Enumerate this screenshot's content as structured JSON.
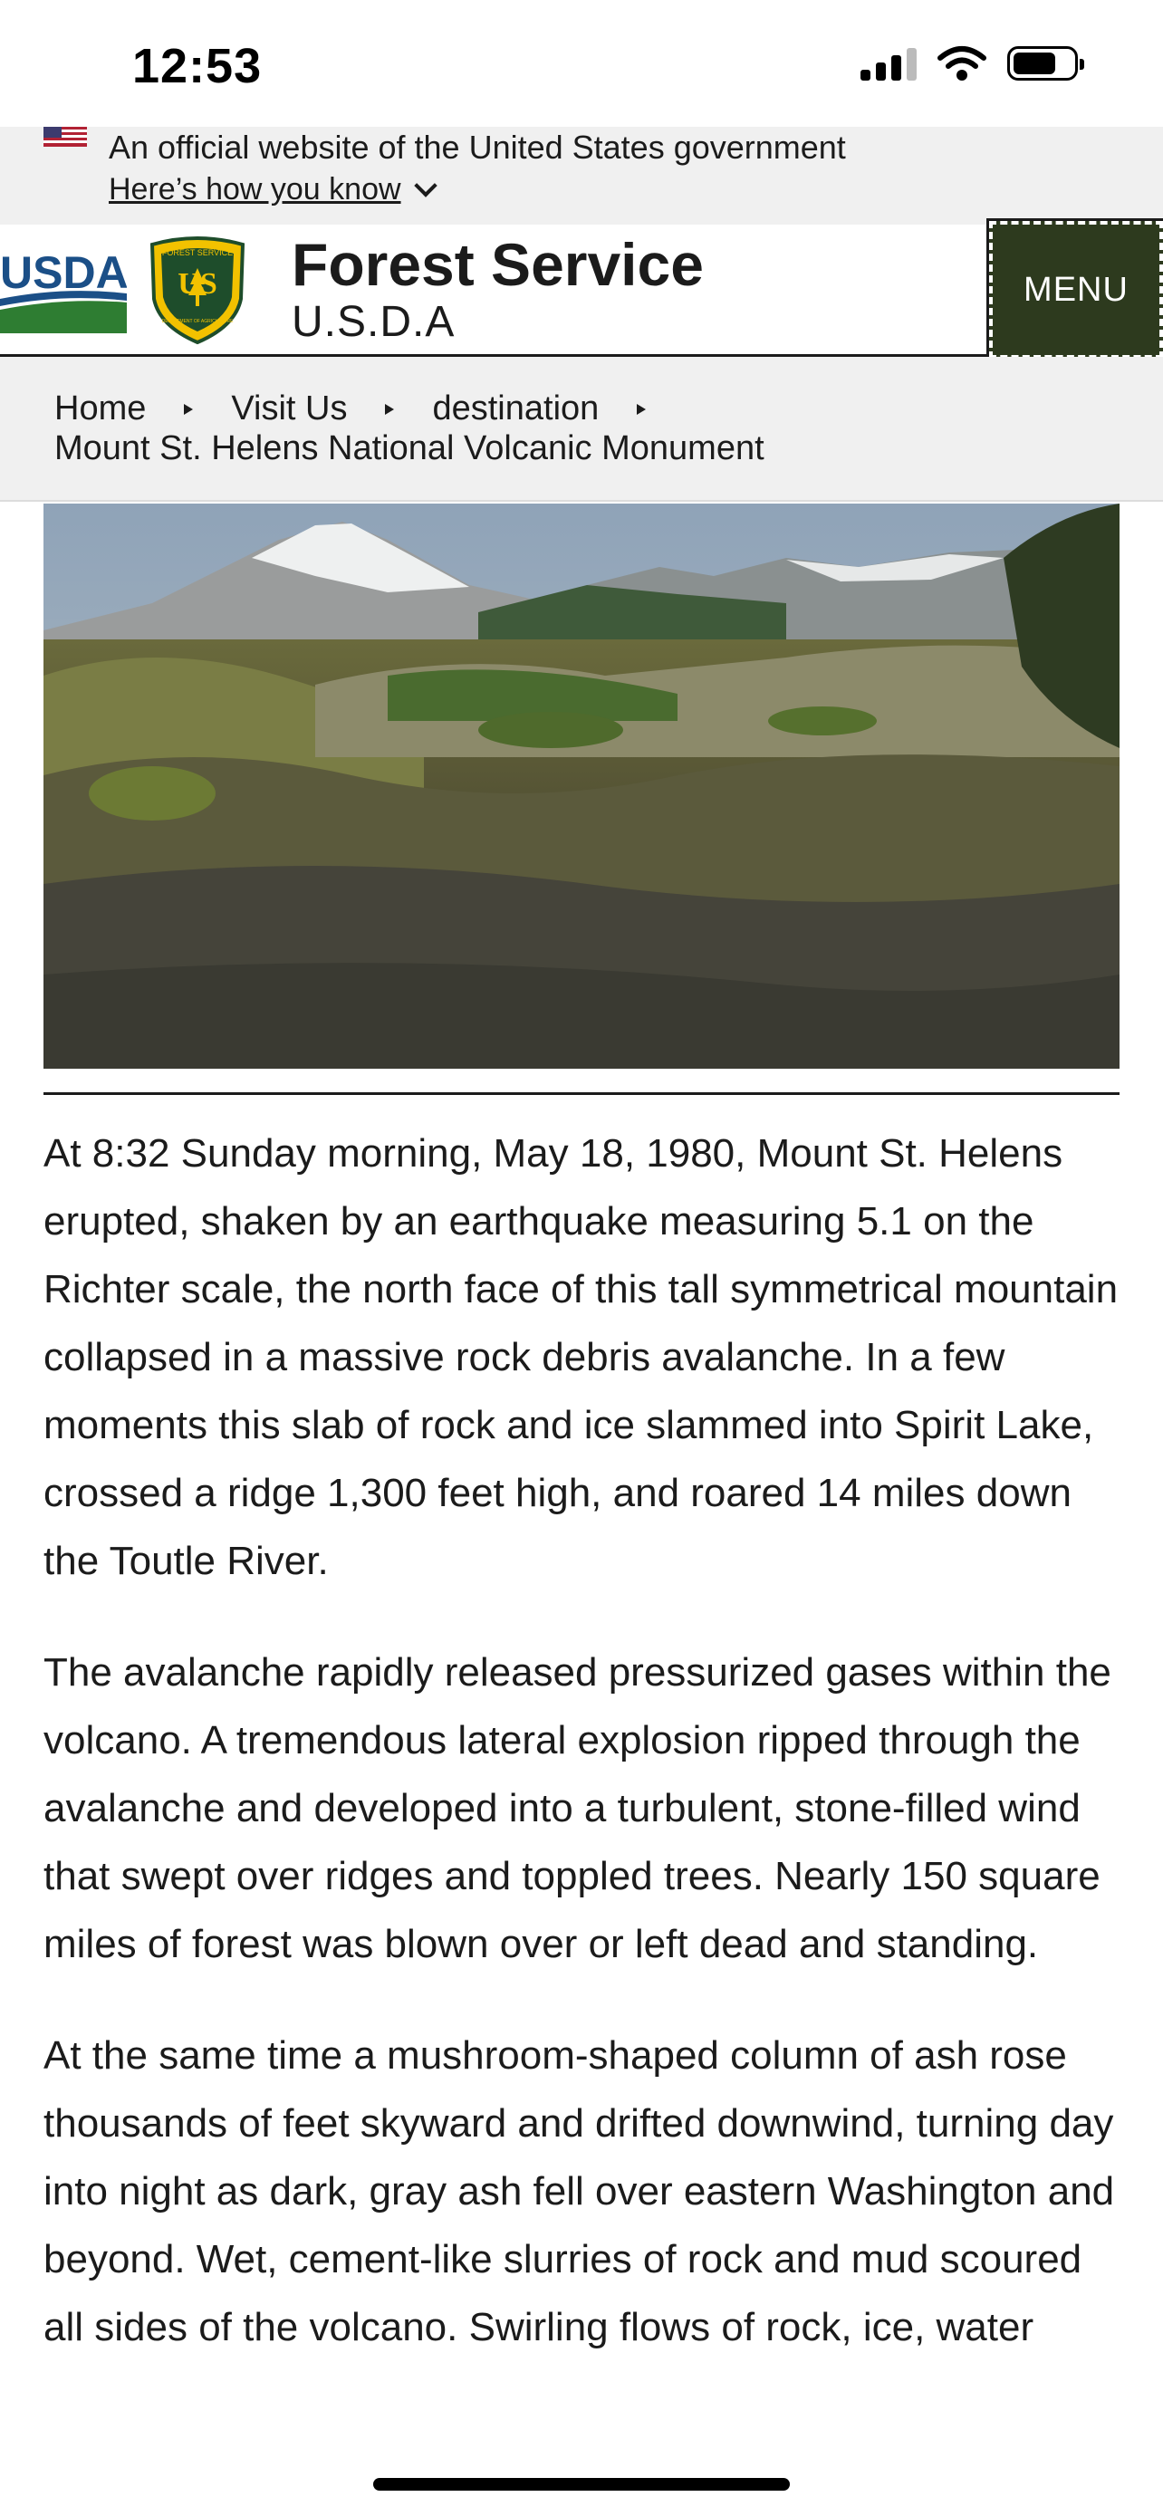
{
  "status_bar": {
    "time": "12:53"
  },
  "gov_banner": {
    "text": "An official website of the United States government",
    "link": "Here’s how you know"
  },
  "header": {
    "logo_text": "USDA",
    "shield_text": "FOREST SERVICE",
    "shield_monogram": "US",
    "shield_bottom_text": "DEPARTMENT OF AGRICULTURE",
    "title": "Forest Service",
    "subtitle": "U.S.D.A",
    "menu_label": "MENU"
  },
  "breadcrumb": {
    "items": [
      "Home",
      "Visit Us",
      "destination"
    ],
    "current": "Mount St. Helens National Volcanic Monument"
  },
  "colors": {
    "accent_green": "#2d3a1e",
    "usda_blue": "#1b4f87",
    "usda_green": "#2e7d32",
    "shield_yellow": "#f2c200"
  },
  "article": {
    "paragraphs": [
      "At 8:32 Sunday morning, May 18, 1980, Mount St. Helens erupted, shaken by an earthquake measuring 5.1 on the Richter scale, the north face of this tall symmetrical mountain collapsed in a massive rock debris avalanche. In a few moments this slab of rock and ice slammed into Spirit Lake, crossed a ridge 1,300 feet high, and roared 14 miles down the Toutle River.",
      "The avalanche rapidly released pressurized gases within the volcano. A tremendous lateral explosion ripped through the avalanche and developed into a turbulent, stone-filled wind that swept over ridges and toppled trees. Nearly 150 square miles of forest was blown over or left dead and standing.",
      "At the same time a mushroom-shaped column of ash rose thousands of feet skyward and drifted downwind, turning day into night as dark, gray ash fell over eastern Washington and beyond. Wet, cement-like slurries of rock and mud scoured all sides of the volcano. Swirling flows of rock, ice, water"
    ]
  }
}
